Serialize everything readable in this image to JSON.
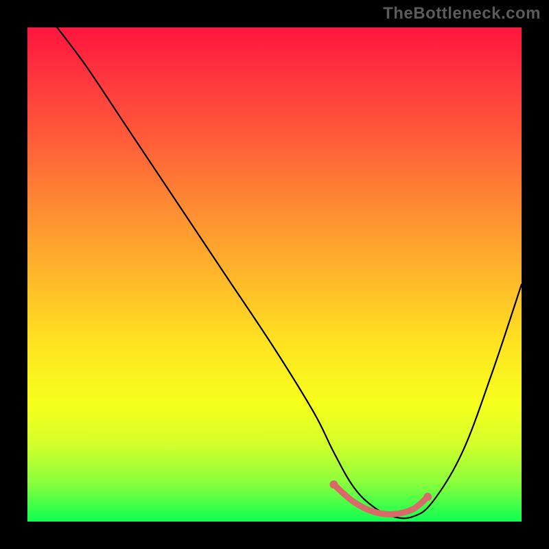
{
  "watermark": "TheBottleneck.com",
  "chart_data": {
    "type": "line",
    "title": "",
    "xlabel": "",
    "ylabel": "",
    "xlim": [
      0,
      100
    ],
    "ylim": [
      0,
      100
    ],
    "series": [
      {
        "name": "bottleneck-curve",
        "x": [
          6,
          12,
          20,
          30,
          40,
          50,
          58,
          62,
          66,
          70,
          74,
          78,
          82,
          88,
          94,
          100
        ],
        "values": [
          100,
          92,
          80,
          65,
          50,
          35,
          22,
          14,
          7,
          3,
          1,
          1,
          4,
          14,
          30,
          48
        ]
      }
    ],
    "highlight_segment": {
      "name": "optimal-range",
      "x": [
        62,
        66,
        70,
        74,
        78,
        81
      ],
      "values": [
        7.5,
        4,
        2,
        1.5,
        2.5,
        5
      ]
    },
    "gradient_stops": [
      {
        "pos": 0.0,
        "color": "#ff153e"
      },
      {
        "pos": 0.22,
        "color": "#ff5a3a"
      },
      {
        "pos": 0.5,
        "color": "#ffb62a"
      },
      {
        "pos": 0.76,
        "color": "#f6ff1c"
      },
      {
        "pos": 0.92,
        "color": "#8cff3c"
      },
      {
        "pos": 1.0,
        "color": "#12ff55"
      }
    ]
  }
}
